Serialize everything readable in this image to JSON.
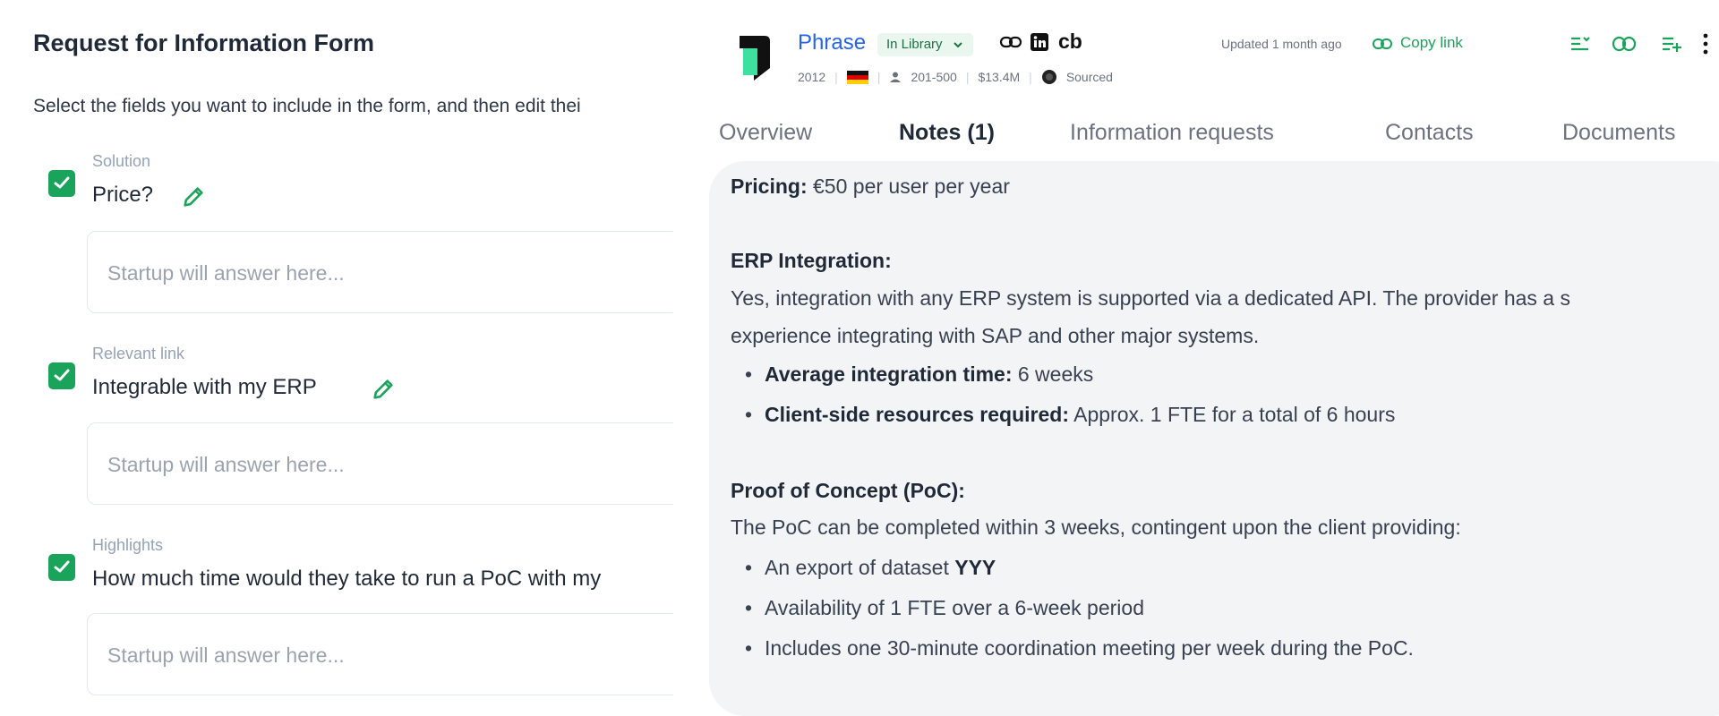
{
  "form": {
    "title": "Request for Information Form",
    "description": "Select the fields you want to include in the form, and then edit thei",
    "fields": [
      {
        "category": "Solution",
        "question": "Price?",
        "placeholder": "Startup will answer here...",
        "checked": true
      },
      {
        "category": "Relevant link",
        "question": "Integrable with my ERP",
        "placeholder": "Startup will answer here...",
        "checked": true
      },
      {
        "category": "Highlights",
        "question": "How much time would they take to run a PoC with my",
        "placeholder": "Startup will answer here...",
        "checked": true
      }
    ]
  },
  "company": {
    "name": "Phrase",
    "library_badge": "In Library",
    "cb_label": "cb",
    "year": "2012",
    "employees": "201-500",
    "funding": "$13.4M",
    "status": "Sourced",
    "updated": "Updated 1 month ago",
    "copy_link": "Copy link"
  },
  "tabs": [
    "Overview",
    "Notes (1)",
    "Information requests",
    "Contacts",
    "Documents"
  ],
  "active_tab": "Notes (1)",
  "notes": {
    "pricing_label": "Pricing:",
    "pricing_value": " €50 per user per year",
    "erp_heading": "ERP Integration:",
    "erp_line1": " Yes, integration with any ERP system is supported via a dedicated API. The provider has a s",
    "erp_line2": "experience integrating with SAP and other major systems.",
    "erp_bullets": [
      {
        "label": "Average integration time:",
        "value": " 6 weeks"
      },
      {
        "label": "Client-side resources required:",
        "value": " Approx. 1 FTE for a total of 6 hours"
      }
    ],
    "poc_heading": "Proof of Concept (PoC):",
    "poc_line": " The PoC can be completed within 3 weeks, contingent upon the client providing:",
    "poc_bullet1_text": "An export of dataset ",
    "poc_bullet1_bold": "YYY",
    "poc_bullet2": "Availability of 1 FTE over a 6-week period",
    "poc_bullet3": " Includes one 30-minute coordination meeting per week during the PoC."
  },
  "colors": {
    "accent_green": "#1aa35a",
    "link_blue": "#2563eb",
    "notes_bg": "#f3f4f6"
  },
  "icons": [
    "checkbox-checked-icon",
    "pencil-icon",
    "chevron-down-icon",
    "link-icon",
    "linkedin-icon",
    "person-icon",
    "status-icon",
    "list-icon",
    "compare-icon",
    "add-to-list-icon",
    "more-vertical-icon"
  ]
}
